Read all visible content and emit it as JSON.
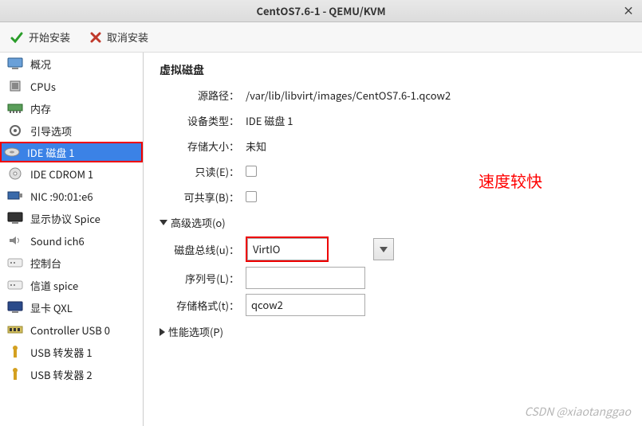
{
  "window": {
    "title": "CentOS7.6-1 - QEMU/KVM"
  },
  "toolbar": {
    "start_install": "开始安装",
    "cancel_install": "取消安装"
  },
  "sidebar": {
    "items": [
      {
        "label": "概况"
      },
      {
        "label": "CPUs"
      },
      {
        "label": "内存"
      },
      {
        "label": "引导选项"
      },
      {
        "label": "IDE 磁盘 1"
      },
      {
        "label": "IDE CDROM 1"
      },
      {
        "label": "NIC :90:01:e6"
      },
      {
        "label": "显示协议 Spice"
      },
      {
        "label": "Sound ich6"
      },
      {
        "label": "控制台"
      },
      {
        "label": "信道 spice"
      },
      {
        "label": "显卡 QXL"
      },
      {
        "label": "Controller USB 0"
      },
      {
        "label": "USB 转发器 1"
      },
      {
        "label": "USB 转发器 2"
      }
    ]
  },
  "detail": {
    "title": "虚拟磁盘",
    "rows": {
      "source_path_label": "源路径：",
      "source_path_value": "/var/lib/libvirt/images/CentOS7.6-1.qcow2",
      "device_type_label": "设备类型：",
      "device_type_value": "IDE 磁盘 1",
      "storage_size_label": "存储大小：",
      "storage_size_value": "未知",
      "readonly_label": "只读(E)：",
      "shareable_label": "可共享(B)："
    },
    "advanced": {
      "header": "高级选项(o)",
      "disk_bus_label": "磁盘总线(u)：",
      "disk_bus_value": "VirtIO",
      "serial_label": "序列号(L)：",
      "serial_value": "",
      "storage_format_label": "存储格式(t)：",
      "storage_format_value": "qcow2"
    },
    "performance": {
      "header": "性能选项(P)"
    }
  },
  "annotation": "速度较快",
  "watermark": "CSDN @xiaotanggao"
}
